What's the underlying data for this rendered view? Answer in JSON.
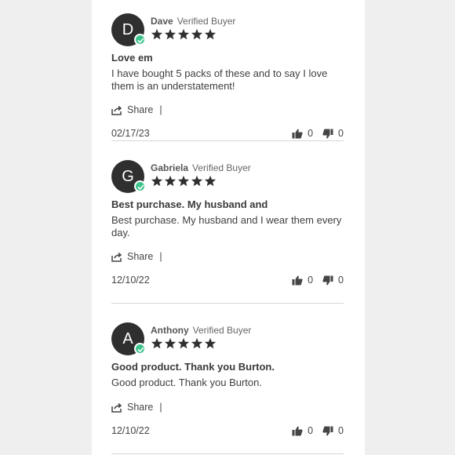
{
  "reviews": [
    {
      "initial": "D",
      "author": "Dave",
      "badge": "Verified Buyer",
      "rating": 5,
      "title": "Love em",
      "body": "I have bought 5 packs of these and to say I love them is an understatement!",
      "share_label": "Share",
      "separator": "|",
      "date": "02/17/23",
      "upvotes": "0",
      "downvotes": "0"
    },
    {
      "initial": "G",
      "author": "Gabriela",
      "badge": "Verified Buyer",
      "rating": 5,
      "title": "Best purchase. My husband and",
      "body": "Best purchase. My husband and I wear them every day.",
      "share_label": "Share",
      "separator": "|",
      "date": "12/10/22",
      "upvotes": "0",
      "downvotes": "0"
    },
    {
      "initial": "A",
      "author": "Anthony",
      "badge": "Verified Buyer",
      "rating": 5,
      "title": "Good product. Thank you Burton.",
      "body": "Good product. Thank you Burton.",
      "share_label": "Share",
      "separator": "|",
      "date": "12/10/22",
      "upvotes": "0",
      "downvotes": "0"
    }
  ],
  "colors": {
    "avatar": "#2f2f2f",
    "verified_check": "#3ec38c",
    "stars": "#2f2f2f"
  },
  "icons": {
    "share": "share-icon",
    "upvote": "thumbs-up-icon",
    "downvote": "thumbs-down-icon",
    "verified": "check-icon",
    "star": "star-icon"
  }
}
